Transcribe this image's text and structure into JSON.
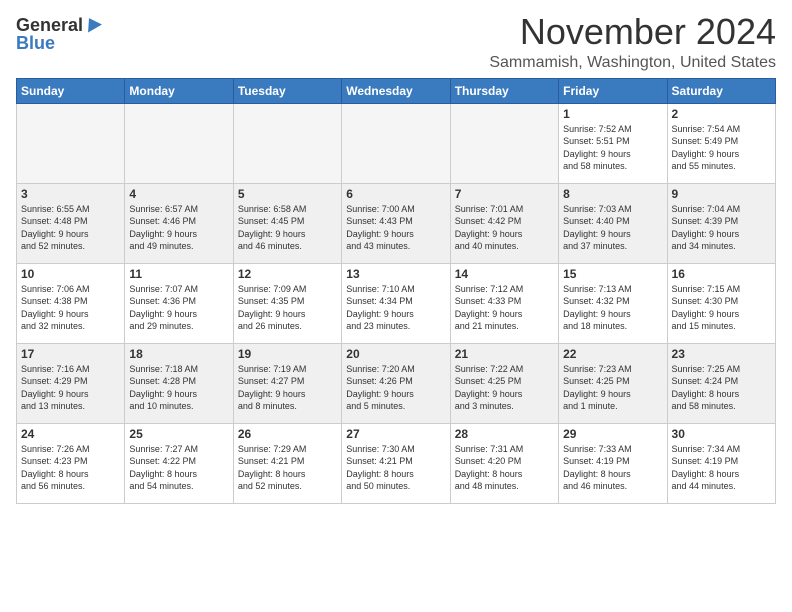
{
  "logo": {
    "general": "General",
    "blue": "Blue"
  },
  "title": "November 2024",
  "location": "Sammamish, Washington, United States",
  "days_of_week": [
    "Sunday",
    "Monday",
    "Tuesday",
    "Wednesday",
    "Thursday",
    "Friday",
    "Saturday"
  ],
  "weeks": [
    [
      {
        "day": "",
        "info": ""
      },
      {
        "day": "",
        "info": ""
      },
      {
        "day": "",
        "info": ""
      },
      {
        "day": "",
        "info": ""
      },
      {
        "day": "",
        "info": ""
      },
      {
        "day": "1",
        "info": "Sunrise: 7:52 AM\nSunset: 5:51 PM\nDaylight: 9 hours\nand 58 minutes."
      },
      {
        "day": "2",
        "info": "Sunrise: 7:54 AM\nSunset: 5:49 PM\nDaylight: 9 hours\nand 55 minutes."
      }
    ],
    [
      {
        "day": "3",
        "info": "Sunrise: 6:55 AM\nSunset: 4:48 PM\nDaylight: 9 hours\nand 52 minutes."
      },
      {
        "day": "4",
        "info": "Sunrise: 6:57 AM\nSunset: 4:46 PM\nDaylight: 9 hours\nand 49 minutes."
      },
      {
        "day": "5",
        "info": "Sunrise: 6:58 AM\nSunset: 4:45 PM\nDaylight: 9 hours\nand 46 minutes."
      },
      {
        "day": "6",
        "info": "Sunrise: 7:00 AM\nSunset: 4:43 PM\nDaylight: 9 hours\nand 43 minutes."
      },
      {
        "day": "7",
        "info": "Sunrise: 7:01 AM\nSunset: 4:42 PM\nDaylight: 9 hours\nand 40 minutes."
      },
      {
        "day": "8",
        "info": "Sunrise: 7:03 AM\nSunset: 4:40 PM\nDaylight: 9 hours\nand 37 minutes."
      },
      {
        "day": "9",
        "info": "Sunrise: 7:04 AM\nSunset: 4:39 PM\nDaylight: 9 hours\nand 34 minutes."
      }
    ],
    [
      {
        "day": "10",
        "info": "Sunrise: 7:06 AM\nSunset: 4:38 PM\nDaylight: 9 hours\nand 32 minutes."
      },
      {
        "day": "11",
        "info": "Sunrise: 7:07 AM\nSunset: 4:36 PM\nDaylight: 9 hours\nand 29 minutes."
      },
      {
        "day": "12",
        "info": "Sunrise: 7:09 AM\nSunset: 4:35 PM\nDaylight: 9 hours\nand 26 minutes."
      },
      {
        "day": "13",
        "info": "Sunrise: 7:10 AM\nSunset: 4:34 PM\nDaylight: 9 hours\nand 23 minutes."
      },
      {
        "day": "14",
        "info": "Sunrise: 7:12 AM\nSunset: 4:33 PM\nDaylight: 9 hours\nand 21 minutes."
      },
      {
        "day": "15",
        "info": "Sunrise: 7:13 AM\nSunset: 4:32 PM\nDaylight: 9 hours\nand 18 minutes."
      },
      {
        "day": "16",
        "info": "Sunrise: 7:15 AM\nSunset: 4:30 PM\nDaylight: 9 hours\nand 15 minutes."
      }
    ],
    [
      {
        "day": "17",
        "info": "Sunrise: 7:16 AM\nSunset: 4:29 PM\nDaylight: 9 hours\nand 13 minutes."
      },
      {
        "day": "18",
        "info": "Sunrise: 7:18 AM\nSunset: 4:28 PM\nDaylight: 9 hours\nand 10 minutes."
      },
      {
        "day": "19",
        "info": "Sunrise: 7:19 AM\nSunset: 4:27 PM\nDaylight: 9 hours\nand 8 minutes."
      },
      {
        "day": "20",
        "info": "Sunrise: 7:20 AM\nSunset: 4:26 PM\nDaylight: 9 hours\nand 5 minutes."
      },
      {
        "day": "21",
        "info": "Sunrise: 7:22 AM\nSunset: 4:25 PM\nDaylight: 9 hours\nand 3 minutes."
      },
      {
        "day": "22",
        "info": "Sunrise: 7:23 AM\nSunset: 4:25 PM\nDaylight: 9 hours\nand 1 minute."
      },
      {
        "day": "23",
        "info": "Sunrise: 7:25 AM\nSunset: 4:24 PM\nDaylight: 8 hours\nand 58 minutes."
      }
    ],
    [
      {
        "day": "24",
        "info": "Sunrise: 7:26 AM\nSunset: 4:23 PM\nDaylight: 8 hours\nand 56 minutes."
      },
      {
        "day": "25",
        "info": "Sunrise: 7:27 AM\nSunset: 4:22 PM\nDaylight: 8 hours\nand 54 minutes."
      },
      {
        "day": "26",
        "info": "Sunrise: 7:29 AM\nSunset: 4:21 PM\nDaylight: 8 hours\nand 52 minutes."
      },
      {
        "day": "27",
        "info": "Sunrise: 7:30 AM\nSunset: 4:21 PM\nDaylight: 8 hours\nand 50 minutes."
      },
      {
        "day": "28",
        "info": "Sunrise: 7:31 AM\nSunset: 4:20 PM\nDaylight: 8 hours\nand 48 minutes."
      },
      {
        "day": "29",
        "info": "Sunrise: 7:33 AM\nSunset: 4:19 PM\nDaylight: 8 hours\nand 46 minutes."
      },
      {
        "day": "30",
        "info": "Sunrise: 7:34 AM\nSunset: 4:19 PM\nDaylight: 8 hours\nand 44 minutes."
      }
    ]
  ]
}
